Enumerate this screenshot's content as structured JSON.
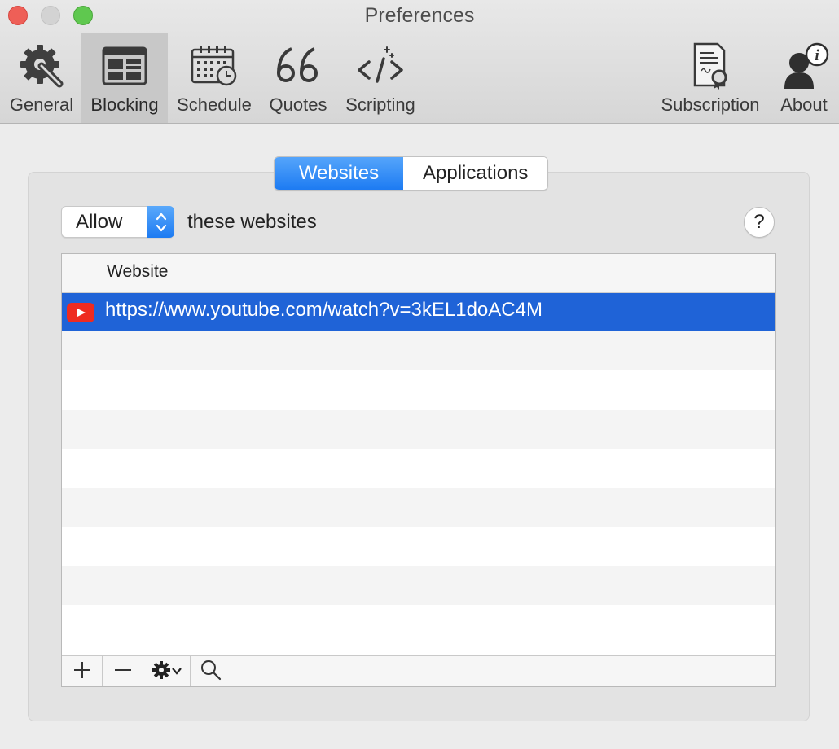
{
  "window": {
    "title": "Preferences"
  },
  "toolbar": {
    "items": [
      {
        "label": "General",
        "icon": "gear-wrench-icon"
      },
      {
        "label": "Blocking",
        "icon": "browser-window-icon",
        "selected": true
      },
      {
        "label": "Schedule",
        "icon": "calendar-clock-icon"
      },
      {
        "label": "Quotes",
        "icon": "quote-marks-icon"
      },
      {
        "label": "Scripting",
        "icon": "code-icon"
      },
      {
        "label": "Subscription",
        "icon": "certificate-icon"
      },
      {
        "label": "About",
        "icon": "person-info-icon"
      }
    ]
  },
  "blocking": {
    "tabs": [
      {
        "label": "Websites",
        "active": true
      },
      {
        "label": "Applications",
        "active": false
      }
    ],
    "mode": {
      "selected": "Allow"
    },
    "rule_text": "these websites",
    "help_label": "?",
    "table": {
      "column_header": "Website",
      "rows": [
        {
          "icon": "youtube-icon",
          "url": "https://www.youtube.com/watch?v=3kEL1doAC4M",
          "selected": true
        }
      ]
    }
  },
  "colors": {
    "accent": "#1d7bf2",
    "selection": "#1f63d7",
    "youtube": "#ee2b20"
  }
}
